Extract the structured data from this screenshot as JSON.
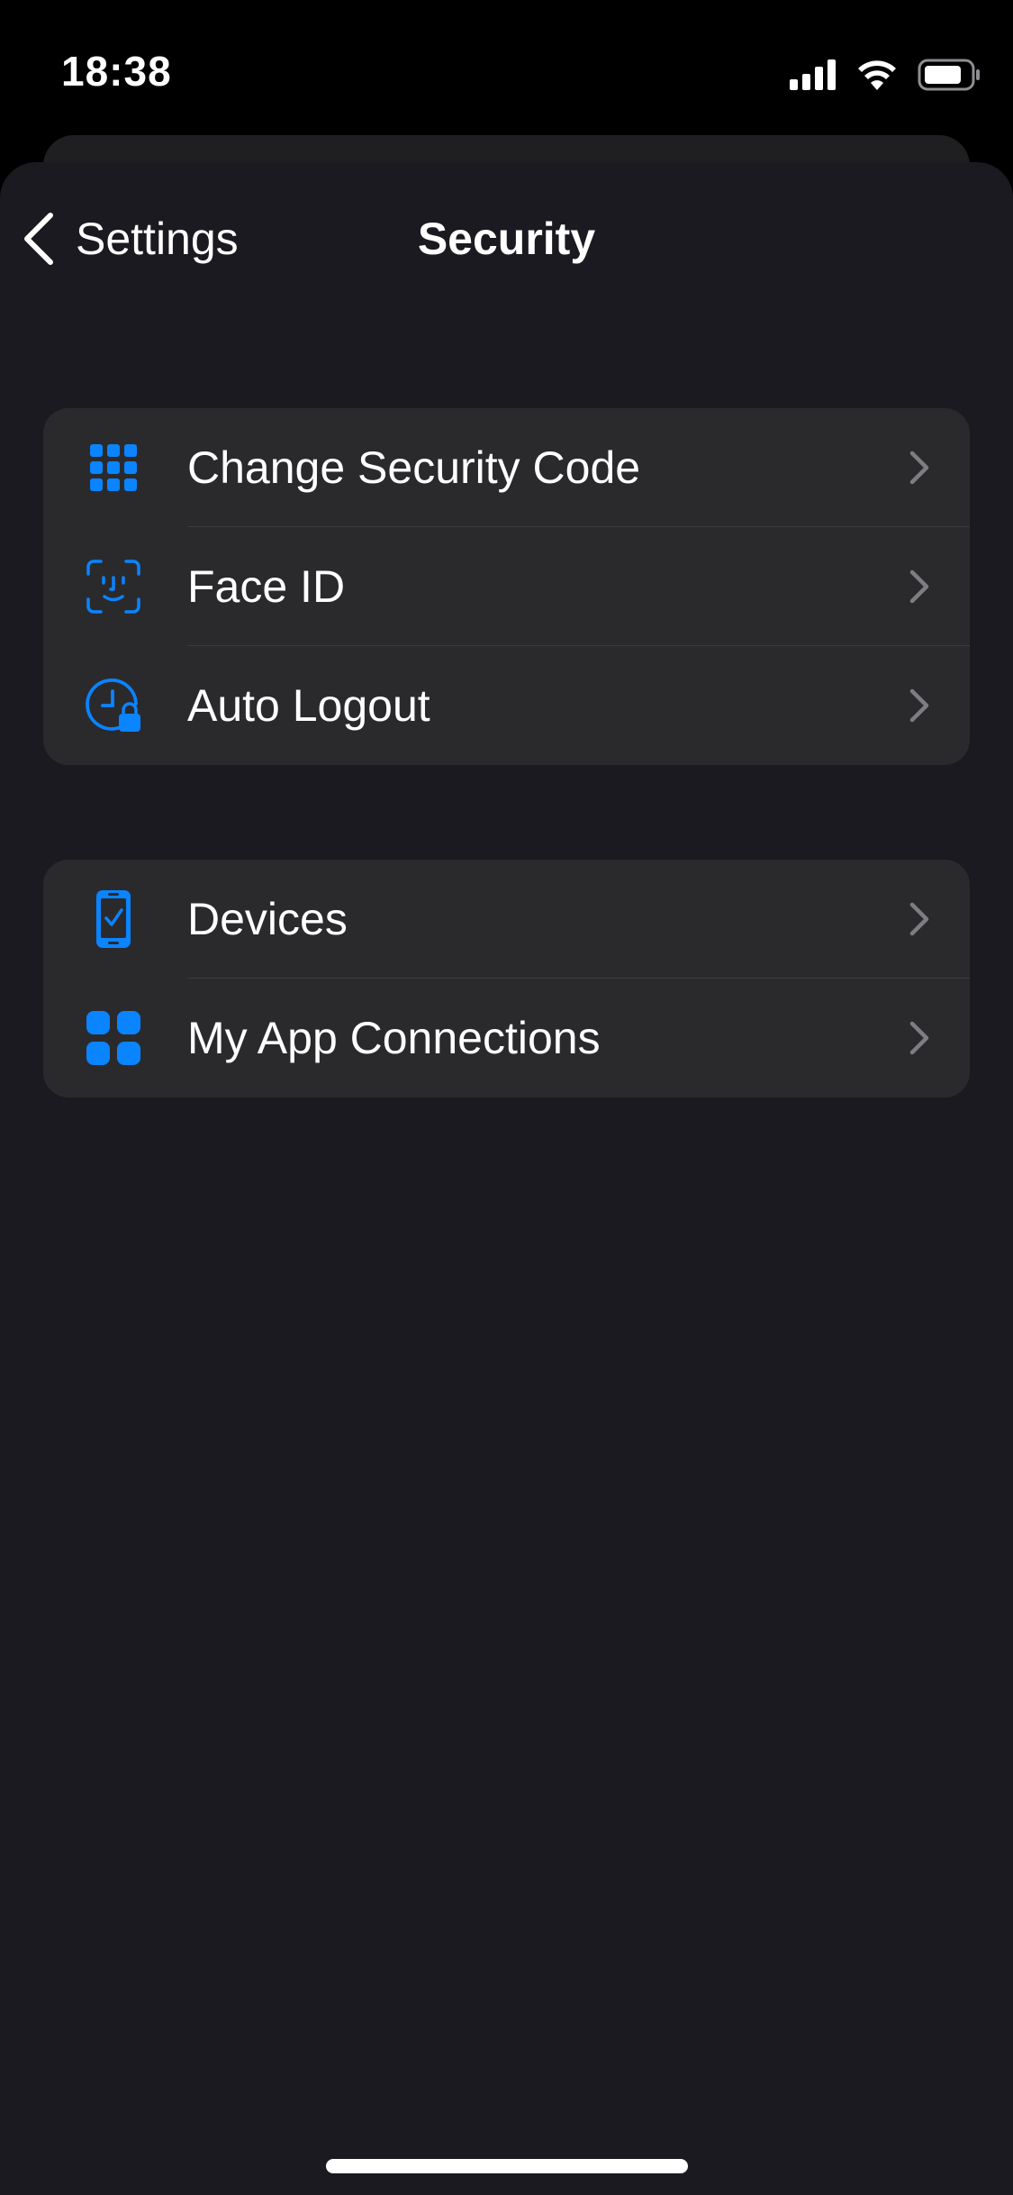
{
  "status_bar": {
    "time": "18:38",
    "icons": [
      "cellular-signal-icon",
      "wifi-icon",
      "battery-icon"
    ]
  },
  "navbar": {
    "back_label": "Settings",
    "title": "Security"
  },
  "groups": [
    {
      "items": [
        {
          "label": "Change Security Code",
          "icon": "keypad-icon"
        },
        {
          "label": "Face ID",
          "icon": "face-id-icon"
        },
        {
          "label": "Auto Logout",
          "icon": "clock-lock-icon"
        }
      ]
    },
    {
      "items": [
        {
          "label": "Devices",
          "icon": "phone-check-icon"
        },
        {
          "label": "My App Connections",
          "icon": "app-grid-icon"
        }
      ]
    }
  ],
  "colors": {
    "accent": "#0a84ff",
    "background": "#1b1a20",
    "cell": "#2a2a2d",
    "chevron": "#7d7d82"
  }
}
